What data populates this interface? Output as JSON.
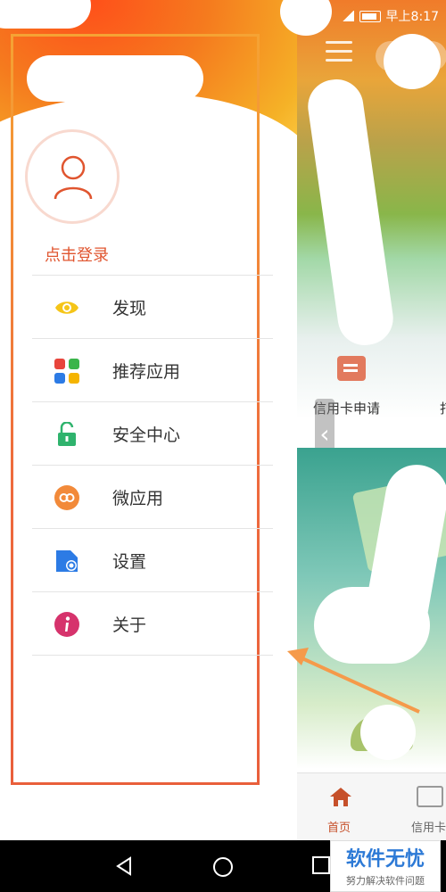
{
  "status_bar": {
    "time": "早上8:17"
  },
  "drawer": {
    "login_label": "点击登录",
    "menu": [
      {
        "label": "发现",
        "icon": "eye-icon"
      },
      {
        "label": "推荐应用",
        "icon": "apps-grid-icon"
      },
      {
        "label": "安全中心",
        "icon": "unlock-icon"
      },
      {
        "label": "微应用",
        "icon": "link-icon"
      },
      {
        "label": "设置",
        "icon": "settings-icon"
      },
      {
        "label": "关于",
        "icon": "info-icon"
      }
    ]
  },
  "background_app": {
    "card_apply_label": "信用卡申请",
    "card_apply_partial": "打",
    "tab_home_label": "首页",
    "tab_card_label": "信用卡"
  },
  "watermark": {
    "title": "软件无忧",
    "subtitle": "努力解决软件问题"
  },
  "colors": {
    "accent": "#e0552f",
    "drawer_gradient_top": "#ff4f1a",
    "drawer_gradient_bottom": "#ffd14a"
  }
}
